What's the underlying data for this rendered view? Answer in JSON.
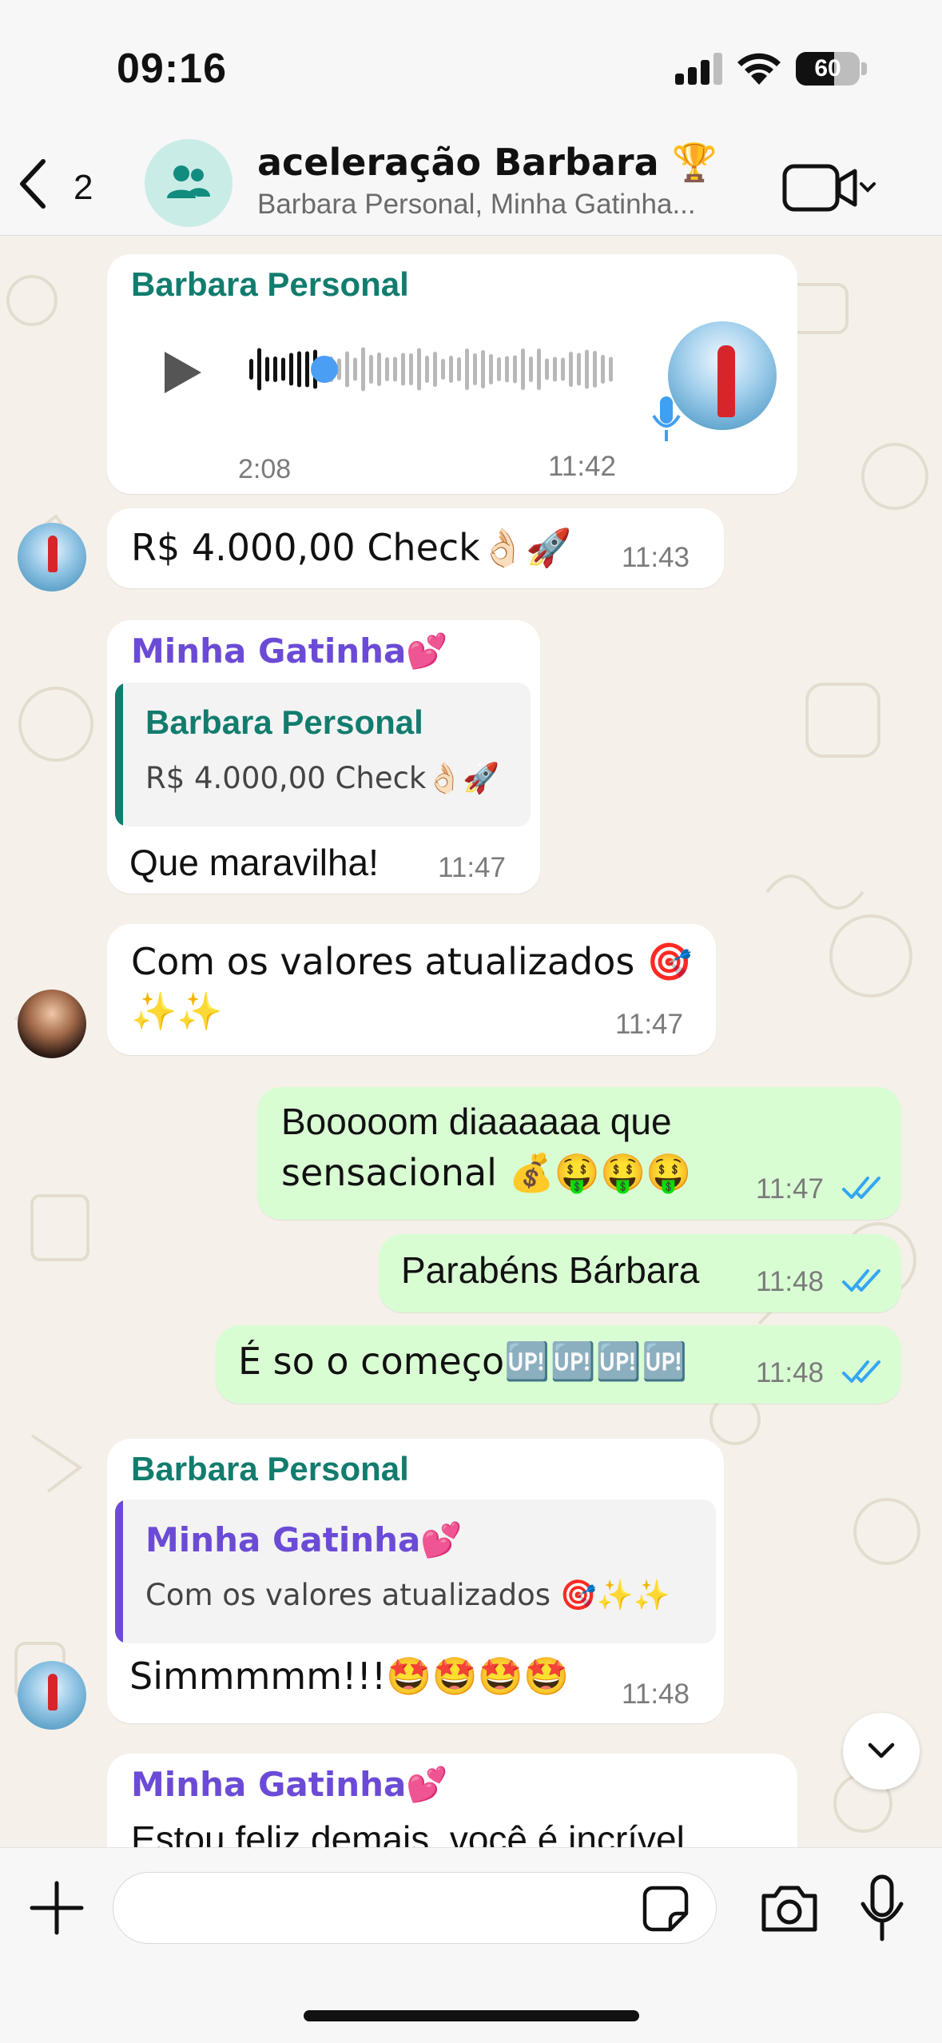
{
  "status_bar": {
    "time": "09:16",
    "battery_percent": "60",
    "battery_level": 0.6
  },
  "header": {
    "back_count": "2",
    "title": "aceleração Barbara 🏆",
    "subtitle": "Barbara Personal, Minha Gatinha..."
  },
  "messages": [
    {
      "type": "audio",
      "sender": "Barbara Personal",
      "duration": "2:08",
      "time": "11:42",
      "played_fraction": 0.2
    },
    {
      "type": "text",
      "direction": "in",
      "text": "R$ 4.000,00 Check👌🏻🚀",
      "time": "11:43"
    },
    {
      "type": "reply",
      "sender": "Minha Gatinha💕",
      "quote_sender": "Barbara Personal",
      "quote_text": "R$ 4.000,00 Check👌🏻🚀",
      "text": "Que maravilha!",
      "time": "11:47"
    },
    {
      "type": "text",
      "direction": "in",
      "line1": "Com os valores atualizados 🎯",
      "line2": "✨✨",
      "time": "11:47"
    },
    {
      "type": "text",
      "direction": "out",
      "line1": "Booooom diaaaaaa que",
      "line2": "sensacional 💰🤑🤑🤑",
      "time": "11:47",
      "status": "read"
    },
    {
      "type": "text",
      "direction": "out",
      "text": "Parabéns Bárbara",
      "time": "11:48",
      "status": "read"
    },
    {
      "type": "text",
      "direction": "out",
      "text": "É so o começo🆙🆙🆙🆙",
      "time": "11:48",
      "status": "read"
    },
    {
      "type": "reply",
      "sender": "Barbara Personal",
      "quote_sender": "Minha Gatinha💕",
      "quote_text": "Com os valores atualizados 🎯✨✨",
      "text": "Simmmmm!!!🤩🤩🤩🤩",
      "time": "11:48"
    },
    {
      "type": "text",
      "direction": "in",
      "sender": "Minha Gatinha💕",
      "text": "Estou feliz demais, você é incrível"
    }
  ],
  "composer": {
    "placeholder": ""
  },
  "colors": {
    "accent_teal": "#127c6e",
    "accent_purple": "#6b4bd6",
    "tick_blue": "#34a6f4",
    "outgoing_bg": "#d9fdd3"
  }
}
